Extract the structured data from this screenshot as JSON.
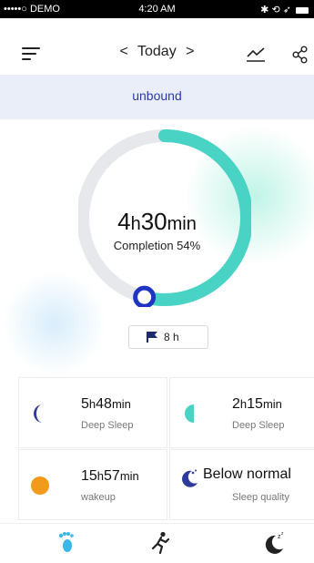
{
  "status_bar": {
    "carrier": "•••••○ DEMO",
    "time": "4:20 AM",
    "icons": "bluetooth-icon, rotation-icon, location-icon, battery-icon"
  },
  "nav": {
    "title": "Today",
    "prev_arrow": "<",
    "next_arrow": ">"
  },
  "banner": {
    "text": "unbound"
  },
  "sleep": {
    "hours": "4",
    "h_unit": "h",
    "minutes": "30",
    "min_unit": "min",
    "completion_label": "Completion 54%",
    "completion": 0.54
  },
  "goal": {
    "value": "8 h"
  },
  "stats": [
    {
      "hours": "5",
      "h_unit": "h",
      "minutes": "48",
      "min_unit": "min",
      "label": "Deep Sleep",
      "icon": "moon-icon",
      "color": "#2d3a9b"
    },
    {
      "hours": "2",
      "h_unit": "h",
      "minutes": "15",
      "min_unit": "min",
      "label": "Deep Sleep",
      "icon": "half-moon-icon",
      "color": "#49d3c4"
    },
    {
      "hours": "15",
      "h_unit": "h",
      "minutes": "57",
      "min_unit": "min",
      "label": "wakeup",
      "icon": "sun-dot-icon",
      "color": "#f29a1c"
    },
    {
      "value": "Below normal",
      "label": "Sleep quality",
      "icon": "sleep-quality-icon",
      "color": "#2d3a9b"
    }
  ],
  "colors": {
    "accent": "#49d3c4",
    "primary": "#2034c4",
    "ring_track": "#e6e8ec"
  }
}
